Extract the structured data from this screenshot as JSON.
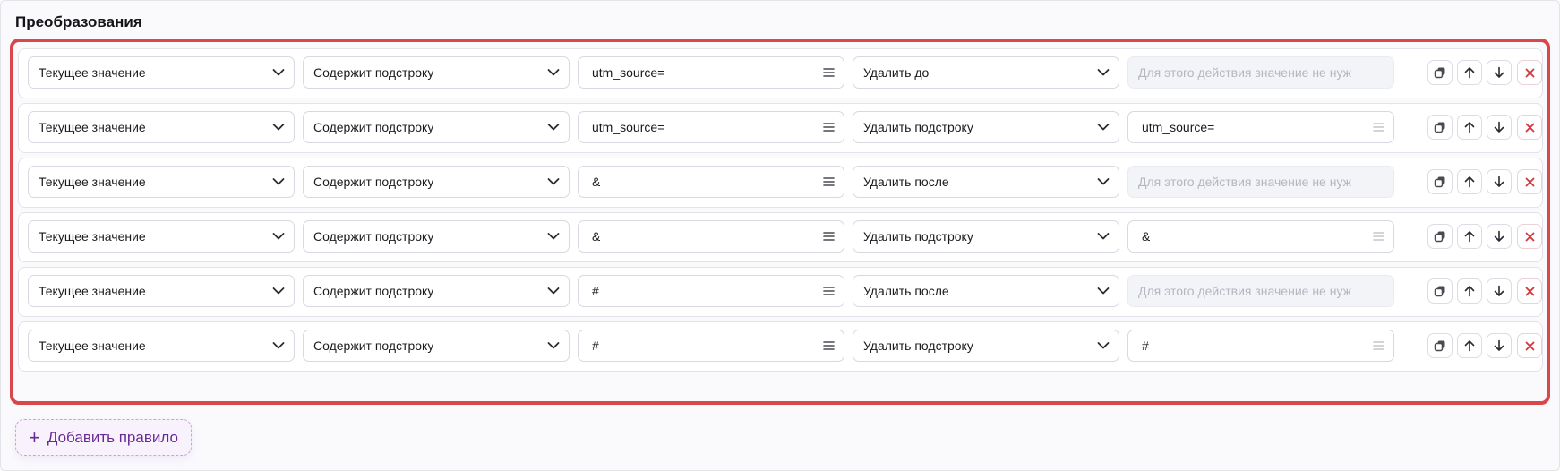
{
  "section": {
    "title": "Преобразования"
  },
  "rules": [
    {
      "source": "Текущее значение",
      "condition": "Содержит подстроку",
      "match": "utm_source=",
      "action": "Удалить до",
      "value": "",
      "value_placeholder": "Для этого действия значение не нуж",
      "value_disabled": true
    },
    {
      "source": "Текущее значение",
      "condition": "Содержит подстроку",
      "match": "utm_source=",
      "action": "Удалить подстроку",
      "value": "utm_source=",
      "value_placeholder": "",
      "value_disabled": false
    },
    {
      "source": "Текущее значение",
      "condition": "Содержит подстроку",
      "match": "&",
      "action": "Удалить после",
      "value": "",
      "value_placeholder": "Для этого действия значение не нуж",
      "value_disabled": true
    },
    {
      "source": "Текущее значение",
      "condition": "Содержит подстроку",
      "match": "&",
      "action": "Удалить подстроку",
      "value": "&",
      "value_placeholder": "",
      "value_disabled": false
    },
    {
      "source": "Текущее значение",
      "condition": "Содержит подстроку",
      "match": "#",
      "action": "Удалить после",
      "value": "",
      "value_placeholder": "Для этого действия значение не нуж",
      "value_disabled": true
    },
    {
      "source": "Текущее значение",
      "condition": "Содержит подстроку",
      "match": "#",
      "action": "Удалить подстроку",
      "value": "#",
      "value_placeholder": "",
      "value_disabled": false
    }
  ],
  "row_buttons": [
    "copy-icon",
    "arrow-up-icon",
    "arrow-down-icon",
    "close-icon"
  ],
  "add_rule": {
    "plus": "+",
    "label": "Добавить правило"
  },
  "colors": {
    "highlight_border": "#d9474b",
    "add_rule_text": "#6a2a94",
    "delete_icon": "#d6363b"
  }
}
